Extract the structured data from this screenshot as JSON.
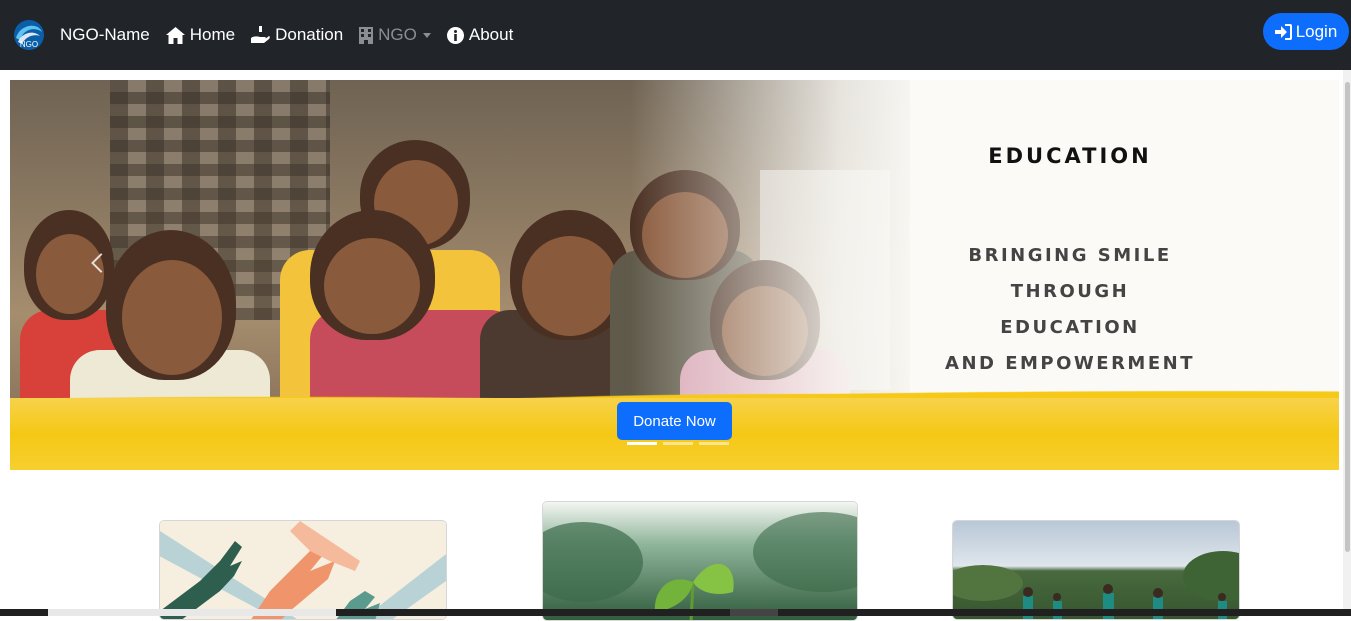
{
  "navbar": {
    "brand": {
      "logo_text": "NGO",
      "name": "NGO-Name"
    },
    "items": [
      {
        "label": "Home",
        "icon": "home-icon"
      },
      {
        "label": "Donation",
        "icon": "hand-holding-heart-icon"
      },
      {
        "label": "NGO",
        "icon": "building-icon",
        "state": "disabled",
        "dropdown": true
      },
      {
        "label": "About",
        "icon": "info-circle-icon"
      }
    ],
    "login": {
      "label": "Login",
      "icon": "sign-in-icon"
    }
  },
  "hero": {
    "title": "EDUCATION",
    "subtitle_lines": [
      "BRINGING SMILE",
      "THROUGH EDUCATION",
      "AND EMPOWERMENT"
    ],
    "cta_label": "Donate Now",
    "slide_count": 3,
    "active_slide": 1
  },
  "colors": {
    "navbar_bg": "#212529",
    "primary": "#0d6efd",
    "accent_yellow": "#f5c816"
  }
}
